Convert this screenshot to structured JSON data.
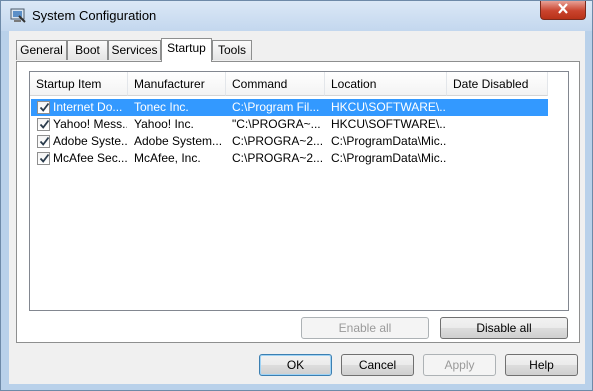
{
  "window": {
    "title": "System Configuration"
  },
  "tabs": [
    {
      "label": "General"
    },
    {
      "label": "Boot"
    },
    {
      "label": "Services"
    },
    {
      "label": "Startup"
    },
    {
      "label": "Tools"
    }
  ],
  "active_tab": "Startup",
  "startup_list": {
    "columns": [
      "Startup Item",
      "Manufacturer",
      "Command",
      "Location",
      "Date Disabled"
    ],
    "rows": [
      {
        "item": "Internet Do...",
        "manufacturer": "Tonec Inc.",
        "command": "C:\\Program Fil...",
        "location": "HKCU\\SOFTWARE\\...",
        "date_disabled": "",
        "checked": true,
        "selected": true
      },
      {
        "item": "Yahoo! Mess...",
        "manufacturer": "Yahoo! Inc.",
        "command": "\"C:\\PROGRA~...",
        "location": "HKCU\\SOFTWARE\\...",
        "date_disabled": "",
        "checked": true,
        "selected": false
      },
      {
        "item": "Adobe Syste...",
        "manufacturer": "Adobe System...",
        "command": "C:\\PROGRA~2...",
        "location": "C:\\ProgramData\\Mic...",
        "date_disabled": "",
        "checked": true,
        "selected": false
      },
      {
        "item": "McAfee Sec...",
        "manufacturer": "McAfee, Inc.",
        "command": "C:\\PROGRA~2...",
        "location": "C:\\ProgramData\\Mic...",
        "date_disabled": "",
        "checked": true,
        "selected": false
      }
    ]
  },
  "panel_buttons": {
    "enable_all": "Enable all",
    "disable_all": "Disable all"
  },
  "dialog_buttons": {
    "ok": "OK",
    "cancel": "Cancel",
    "apply": "Apply",
    "help": "Help"
  },
  "colors": {
    "selection": "#3399ff",
    "title_bar": "#c3d7ee",
    "close_button": "#c9432d"
  }
}
